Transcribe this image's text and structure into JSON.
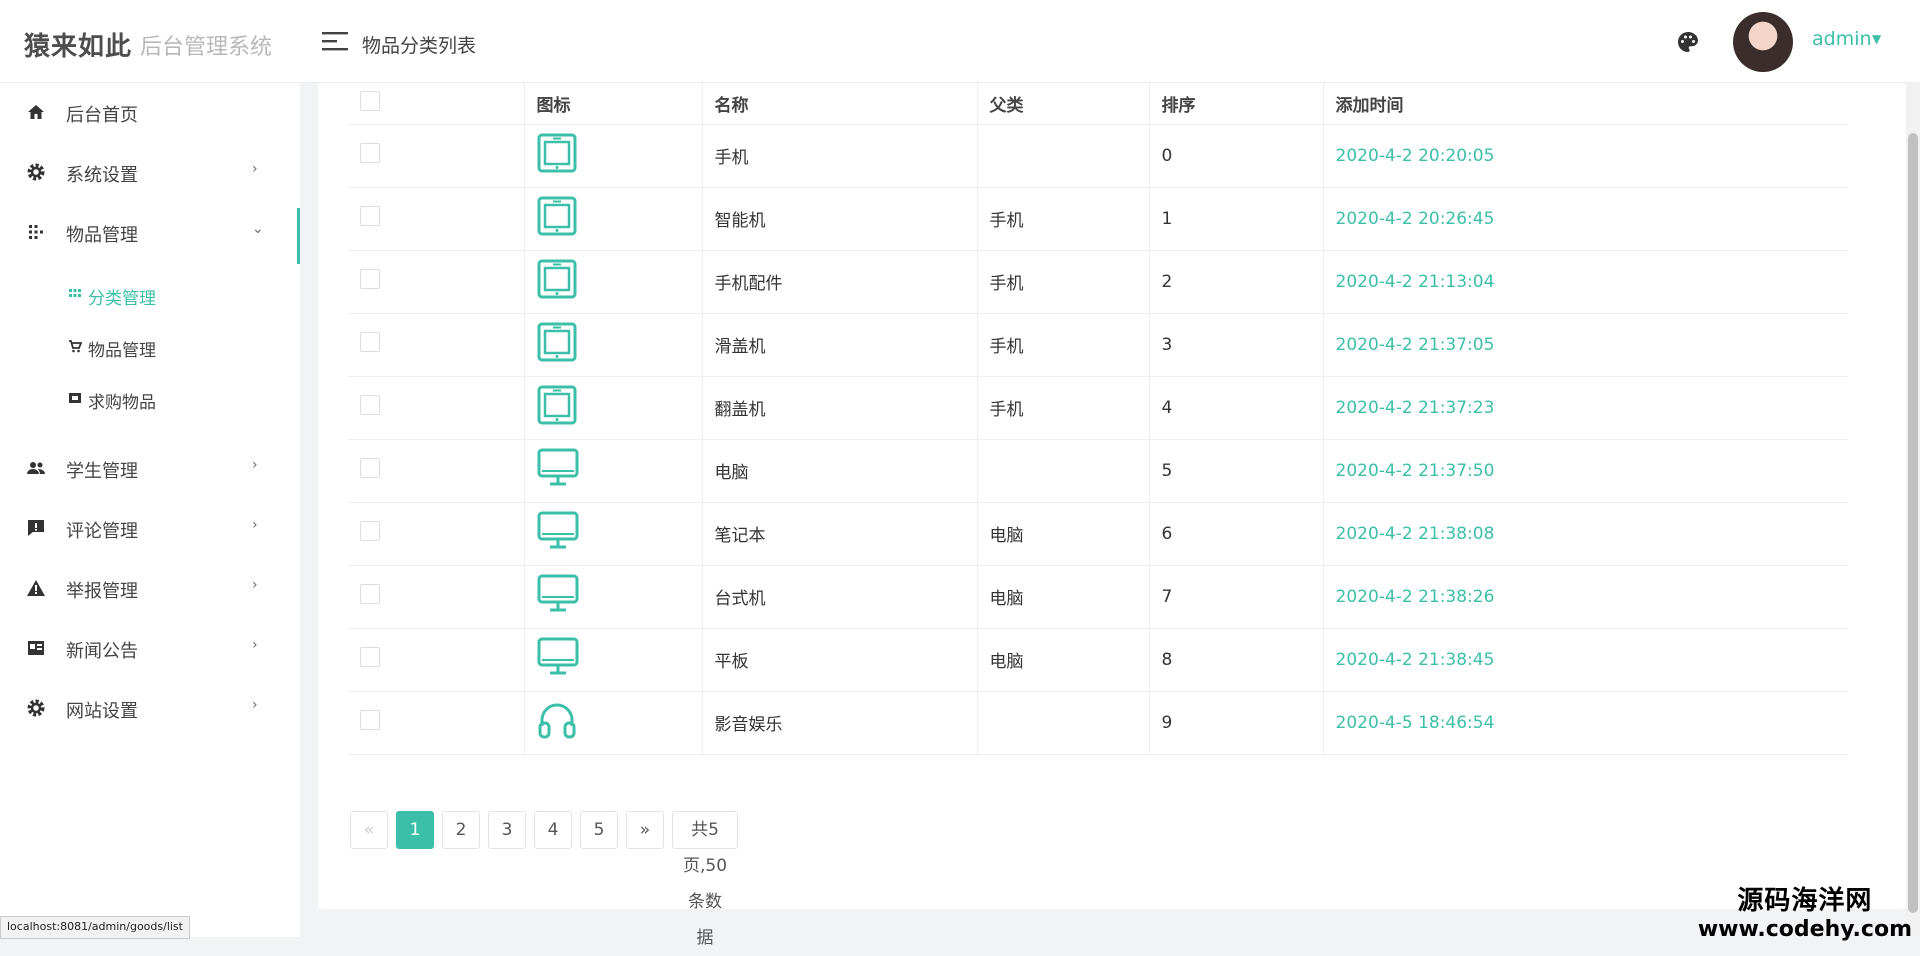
{
  "header": {
    "logo_bold": "猿来如此",
    "logo_sub": "后台管理系统",
    "page_title": "物品分类列表",
    "user_name": "admin"
  },
  "sidebar": {
    "items": [
      {
        "label": "后台首页",
        "icon": "home-icon"
      },
      {
        "label": "系统设置",
        "icon": "gear-icon"
      },
      {
        "label": "物品管理",
        "icon": "grid-icon"
      },
      {
        "label": "学生管理",
        "icon": "people-icon"
      },
      {
        "label": "评论管理",
        "icon": "comment-icon"
      },
      {
        "label": "举报管理",
        "icon": "warning-icon"
      },
      {
        "label": "新闻公告",
        "icon": "news-icon"
      },
      {
        "label": "网站设置",
        "icon": "gear-icon"
      }
    ],
    "sub_items": [
      {
        "label": "分类管理",
        "icon": "grid-small-icon",
        "active": true
      },
      {
        "label": "物品管理",
        "icon": "cart-icon"
      },
      {
        "label": "求购物品",
        "icon": "box-icon"
      }
    ]
  },
  "table": {
    "headers": [
      "",
      "图标",
      "名称",
      "父类",
      "排序",
      "添加时间"
    ],
    "rows": [
      {
        "icon": "tablet-icon",
        "name": "手机",
        "parent": "",
        "sort": "0",
        "time": "2020-4-2 20:20:05"
      },
      {
        "icon": "tablet-icon",
        "name": "智能机",
        "parent": "手机",
        "sort": "1",
        "time": "2020-4-2 20:26:45"
      },
      {
        "icon": "tablet-icon",
        "name": "手机配件",
        "parent": "手机",
        "sort": "2",
        "time": "2020-4-2 21:13:04"
      },
      {
        "icon": "tablet-icon",
        "name": "滑盖机",
        "parent": "手机",
        "sort": "3",
        "time": "2020-4-2 21:37:05"
      },
      {
        "icon": "tablet-icon",
        "name": "翻盖机",
        "parent": "手机",
        "sort": "4",
        "time": "2020-4-2 21:37:23"
      },
      {
        "icon": "monitor-icon",
        "name": "电脑",
        "parent": "",
        "sort": "5",
        "time": "2020-4-2 21:37:50"
      },
      {
        "icon": "monitor-icon",
        "name": "笔记本",
        "parent": "电脑",
        "sort": "6",
        "time": "2020-4-2 21:38:08"
      },
      {
        "icon": "monitor-icon",
        "name": "台式机",
        "parent": "电脑",
        "sort": "7",
        "time": "2020-4-2 21:38:26"
      },
      {
        "icon": "monitor-icon",
        "name": "平板",
        "parent": "电脑",
        "sort": "8",
        "time": "2020-4-2 21:38:45"
      },
      {
        "icon": "headphones-icon",
        "name": "影音娱乐",
        "parent": "",
        "sort": "9",
        "time": "2020-4-5 18:46:54"
      }
    ]
  },
  "pagination": {
    "prev": "«",
    "pages": [
      "1",
      "2",
      "3",
      "4",
      "5"
    ],
    "current": "1",
    "next": "»",
    "info": "共5页,50条数据"
  },
  "status_url": "localhost:8081/admin/goods/list",
  "watermark": {
    "line1": "源码海洋网",
    "line2": "www.codehy.com"
  },
  "colors": {
    "accent": "#3cbfa9",
    "background": "#f1f3f5"
  }
}
